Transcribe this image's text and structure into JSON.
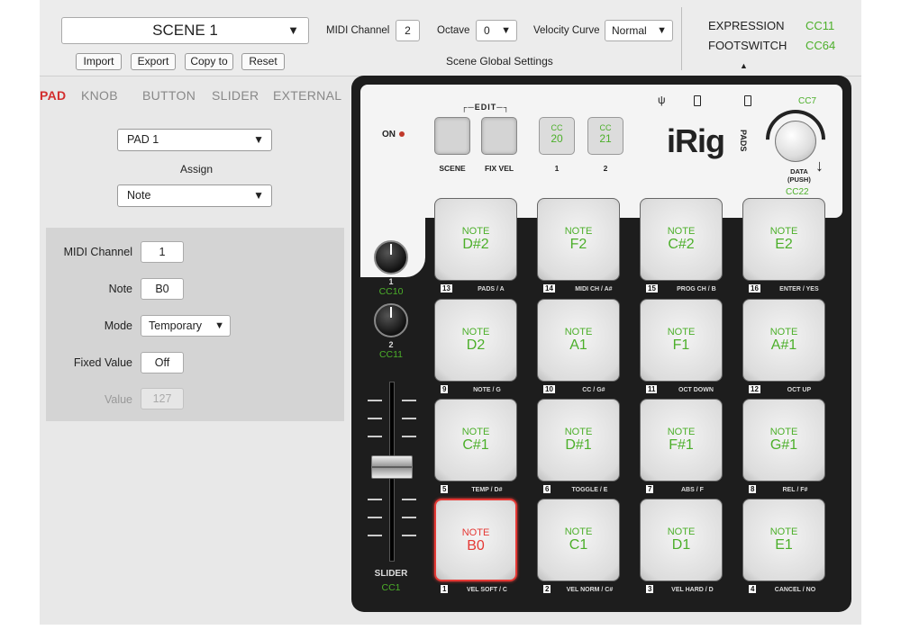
{
  "scene": {
    "name": "SCENE 1",
    "buttons": [
      "Import",
      "Export",
      "Copy to",
      "Reset"
    ]
  },
  "global": {
    "midi_channel_label": "MIDI Channel",
    "midi_channel_value": "2",
    "octave_label": "Octave",
    "octave_value": "0",
    "velocity_label": "Velocity Curve",
    "velocity_value": "Normal",
    "section_title": "Scene Global Settings"
  },
  "pedal": {
    "expression_label": "EXPRESSION",
    "expression_cc": "CC11",
    "footswitch_label": "FOOTSWITCH",
    "footswitch_cc": "CC64"
  },
  "tabs": [
    "PAD",
    "KNOB",
    "BUTTON",
    "SLIDER",
    "EXTERNAL"
  ],
  "left": {
    "pad_select": "PAD 1",
    "assign_label": "Assign",
    "assign_select": "Note",
    "params": {
      "midi_channel_label": "MIDI Channel",
      "midi_channel": "1",
      "note_label": "Note",
      "note": "B0",
      "mode_label": "Mode",
      "mode": "Temporary",
      "fixed_value_label": "Fixed Value",
      "fixed_value": "Off",
      "value_label": "Value",
      "value": "127"
    }
  },
  "device": {
    "on_label": "ON",
    "edit_label": "EDIT",
    "scene_label": "SCENE",
    "fixvel_label": "FIX VEL",
    "cc_btns": [
      {
        "c": "CC",
        "v": "20",
        "n": "1"
      },
      {
        "c": "CC",
        "v": "21",
        "n": "2"
      }
    ],
    "brand": "iRig",
    "brand_sub": "PADS",
    "cc7": "CC7",
    "data_label": "DATA",
    "data_sub": "(PUSH)",
    "cc22": "CC22",
    "knobs": [
      {
        "n": "1",
        "cc": "CC10"
      },
      {
        "n": "2",
        "cc": "CC11"
      }
    ],
    "slider_label": "SLIDER",
    "slider_cc": "CC1"
  },
  "pads": [
    {
      "note": "NOTE",
      "val": "D#2",
      "num": "13",
      "lab": "PADS / A"
    },
    {
      "note": "NOTE",
      "val": "F2",
      "num": "14",
      "lab": "MIDI CH / A#"
    },
    {
      "note": "NOTE",
      "val": "C#2",
      "num": "15",
      "lab": "PROG CH / B"
    },
    {
      "note": "NOTE",
      "val": "E2",
      "num": "16",
      "lab": "ENTER / YES"
    },
    {
      "note": "NOTE",
      "val": "D2",
      "num": "9",
      "lab": "NOTE / G"
    },
    {
      "note": "NOTE",
      "val": "A1",
      "num": "10",
      "lab": "CC / G#"
    },
    {
      "note": "NOTE",
      "val": "F1",
      "num": "11",
      "lab": "OCT DOWN"
    },
    {
      "note": "NOTE",
      "val": "A#1",
      "num": "12",
      "lab": "OCT UP"
    },
    {
      "note": "NOTE",
      "val": "C#1",
      "num": "5",
      "lab": "TEMP / D#"
    },
    {
      "note": "NOTE",
      "val": "D#1",
      "num": "6",
      "lab": "TOGGLE / E"
    },
    {
      "note": "NOTE",
      "val": "F#1",
      "num": "7",
      "lab": "ABS / F"
    },
    {
      "note": "NOTE",
      "val": "G#1",
      "num": "8",
      "lab": "REL / F#"
    },
    {
      "note": "NOTE",
      "val": "B0",
      "num": "1",
      "lab": "VEL SOFT / C"
    },
    {
      "note": "NOTE",
      "val": "C1",
      "num": "2",
      "lab": "VEL NORM / C#"
    },
    {
      "note": "NOTE",
      "val": "D1",
      "num": "3",
      "lab": "VEL HARD / D"
    },
    {
      "note": "NOTE",
      "val": "E1",
      "num": "4",
      "lab": "CANCEL / NO"
    }
  ],
  "selected_pad": "B0",
  "colors": {
    "cc_green": "#4caf2a",
    "selected_red": "#e53935",
    "active_tab": "#d32f2f"
  }
}
